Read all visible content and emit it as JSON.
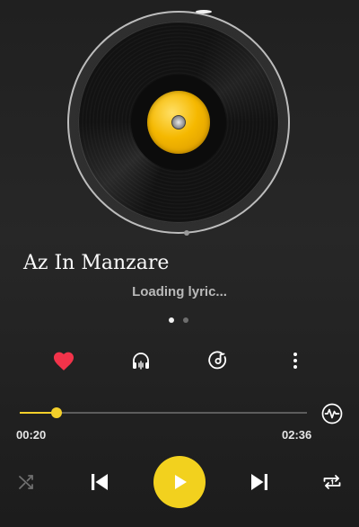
{
  "player": {
    "song_title": "Az In Manzare",
    "lyric_status": "Loading lyric...",
    "current_time": "00:20",
    "total_time": "02:36",
    "progress": 0.128,
    "page_indicator": {
      "active_index": 0,
      "count": 2
    }
  },
  "actions": {
    "favorite": {
      "icon": "heart-icon",
      "active": true
    },
    "headphone": {
      "icon": "headphone-icon"
    },
    "disc_settings": {
      "icon": "disc-music-icon"
    },
    "more": {
      "icon": "more-vertical-icon"
    }
  },
  "controls": {
    "shuffle": {
      "icon": "shuffle-icon"
    },
    "previous": {
      "icon": "skip-previous-icon"
    },
    "play": {
      "icon": "play-icon"
    },
    "next": {
      "icon": "skip-next-icon"
    },
    "repeat": {
      "icon": "repeat-one-icon"
    },
    "waveform": {
      "icon": "waveform-icon"
    }
  },
  "colors": {
    "accent": "#f2d11e",
    "favorite": "#f2334a",
    "background": "#232323"
  }
}
